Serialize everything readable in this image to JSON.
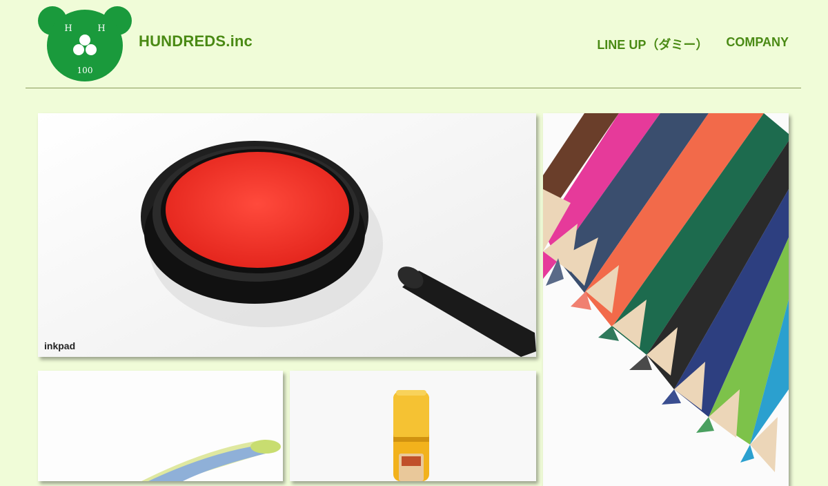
{
  "header": {
    "logo": {
      "letter_left": "H",
      "letter_right": "H",
      "number": "100",
      "color": "#1a9a3c"
    },
    "brand": "HUNDREDS.inc",
    "nav": [
      {
        "label": "LINE UP（ダミー）"
      },
      {
        "label": "COMPANY"
      }
    ]
  },
  "gallery": {
    "items": [
      {
        "id": "inkpad",
        "label": "inkpad",
        "image": "red-inkpad-photo"
      },
      {
        "id": "pencils",
        "label": "",
        "image": "colored-pencils-photo"
      },
      {
        "id": "stapler",
        "label": "",
        "image": "stapler-photo"
      },
      {
        "id": "glue",
        "label": "",
        "image": "glue-stick-photo"
      }
    ]
  },
  "colors": {
    "background": "#f0fcd8",
    "accent": "#4a8a14",
    "logo_green": "#1a9a3c"
  }
}
